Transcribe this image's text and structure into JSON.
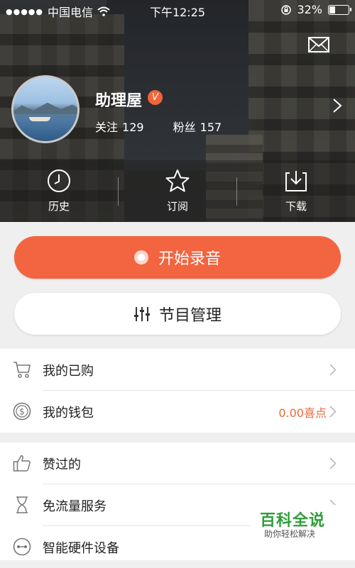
{
  "status_bar": {
    "signal_dots": "●●●●●",
    "carrier": "中国电信",
    "time": "下午12:25",
    "battery": "32%"
  },
  "profile": {
    "name": "助理屋",
    "verified_badge": "V",
    "following_label": "关注",
    "following_count": "129",
    "fans_label": "粉丝",
    "fans_count": "157"
  },
  "quick_actions": [
    {
      "label": "历史",
      "icon": "clock-icon"
    },
    {
      "label": "订阅",
      "icon": "star-icon"
    },
    {
      "label": "下载",
      "icon": "download-icon"
    }
  ],
  "buttons": {
    "record": "开始录音",
    "program": "节目管理"
  },
  "menu_group_1": [
    {
      "label": "我的已购",
      "icon": "cart-icon",
      "value": ""
    },
    {
      "label": "我的钱包",
      "icon": "coin-icon",
      "value": "0.00喜点"
    }
  ],
  "menu_group_2": [
    {
      "label": "赞过的",
      "icon": "thumbs-up-icon"
    },
    {
      "label": "免流量服务",
      "icon": "hourglass-icon"
    },
    {
      "label": "智能硬件设备",
      "icon": "device-icon"
    }
  ],
  "watermark": {
    "title": "百科全说",
    "subtitle": "助你轻松解决"
  },
  "colors": {
    "accent": "#f26540",
    "value_text": "#e86a3c"
  }
}
